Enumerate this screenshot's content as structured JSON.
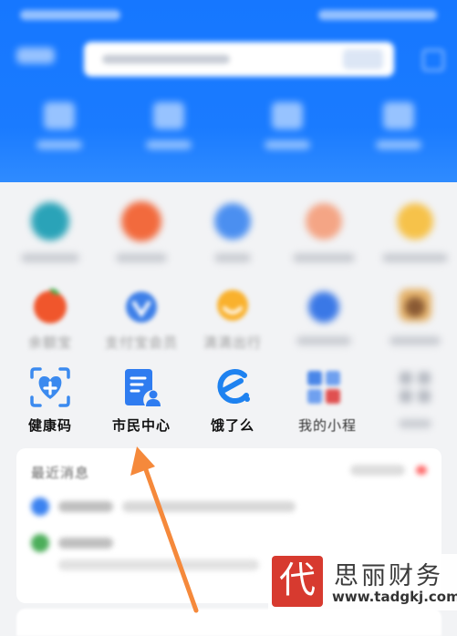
{
  "row2": [
    {
      "label": "余额宝",
      "icon": "orange-fruit-icon"
    },
    {
      "label": "支付宝会员",
      "icon": "member-badge-icon"
    },
    {
      "label": "滴滴出行",
      "icon": "didi-icon"
    }
  ],
  "row3": [
    {
      "label": "健康码",
      "icon": "health-code-icon"
    },
    {
      "label": "市民中心",
      "icon": "citizen-center-icon"
    },
    {
      "label": "饿了么",
      "icon": "eleme-icon"
    },
    {
      "label": "我的小程",
      "icon": "mini-program-icon"
    }
  ],
  "messages": {
    "title": "最近消息"
  },
  "watermark": {
    "seal_char": "代",
    "name": "思丽财务",
    "url": "www.tadgkj.com"
  },
  "colors": {
    "header_blue": "#1677ff",
    "arrow_orange": "#f5893b",
    "seal_red": "#d73a2f"
  }
}
